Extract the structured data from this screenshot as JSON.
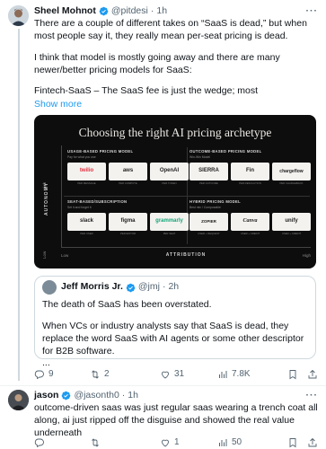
{
  "tweet1": {
    "author_name": "Sheel Mohnot",
    "handle": "@pitdesi",
    "separator": "·",
    "time": "1h",
    "text_p1": "There are a couple of different takes on “SaaS is dead,” but when most people say it, they really mean per-seat pricing is dead.",
    "text_p2": "I think that model is mostly going away and there are many newer/better pricing models for SaaS:",
    "text_p3": "Fintech-SaaS – The SaaS fee is just the wedge; most",
    "show_more": "Show more",
    "actions": {
      "replies": "9",
      "reposts": "2",
      "likes": "31",
      "views": "7.8K"
    }
  },
  "media": {
    "title": "Choosing the right AI pricing archetype",
    "y_label": "AUTONOMY",
    "y_high": "High",
    "y_low": "Low",
    "x_label": "ATTRIBUTION",
    "x_low": "Low",
    "x_high": "High",
    "cells": [
      {
        "title": "USAGE-BASED PRICING MODEL",
        "sub": "Pay for what you use",
        "logos": [
          "twilio",
          "aws",
          "OpenAI"
        ],
        "caps": [
          "PER MESSAGE",
          "PER COMPUTE",
          "PER TOKEN"
        ]
      },
      {
        "title": "OUTCOME-BASED PRICING MODEL",
        "sub": "Win-Win Model",
        "logos": [
          "SIERRA",
          "Fin",
          "chargeflow"
        ],
        "caps": [
          "PER OUTCOME",
          "PER RESOLUTION",
          "PER CHARGEBACK"
        ]
      },
      {
        "title": "SEAT-BASED/SUBSCRIPTION",
        "sub": "Set it and forget it",
        "logos": [
          "slack",
          "figma",
          "grammarly"
        ],
        "caps": [
          "PER USER",
          "PER EDITOR",
          "PER SEAT"
        ]
      },
      {
        "title": "HYBRID PRICING MODEL",
        "sub": "Best mix / Composable",
        "logos": [
          "ZOPIER",
          "Canva",
          "unify"
        ],
        "caps": [
          "USER + REQUEST",
          "USER + CREDIT",
          "USER + CREDIT"
        ]
      }
    ]
  },
  "quote": {
    "author_name": "Jeff Morris Jr.",
    "handle": "@jmj",
    "separator": "·",
    "time": "2h",
    "text_p1": "The death of SaaS has been overstated.",
    "text_p2": "When VCs or industry analysts say that SaaS is dead, they replace the word SaaS with AI agents or some other descriptor for B2B software.",
    "ellipsis": "..."
  },
  "tweet2": {
    "author_name": "jason",
    "handle": "@jasonth0",
    "separator": "·",
    "time": "1h",
    "text": "outcome-driven saas was just regular saas wearing a trench coat all along, ai just ripped off the disguise and showed the real value underneath",
    "actions": {
      "replies": "",
      "reposts": "",
      "likes": "1",
      "views": "50"
    }
  },
  "colors": {
    "accent": "#1d9bf0",
    "muted": "#536471",
    "border": "#cfd9de"
  }
}
